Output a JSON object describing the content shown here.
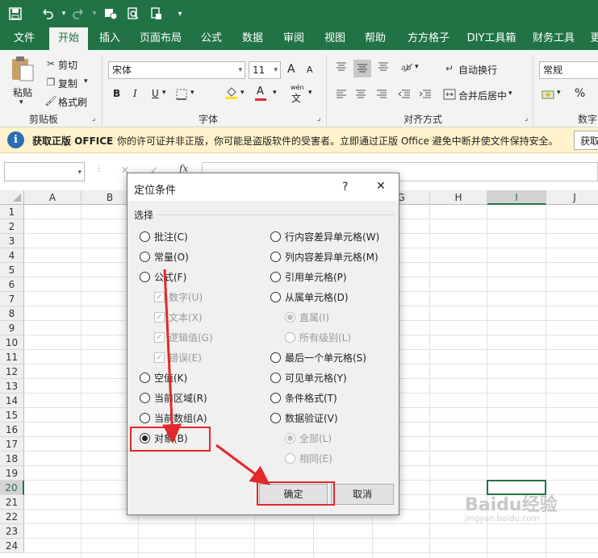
{
  "quick_access": {
    "icons": [
      "save-icon",
      "undo-icon",
      "redo-icon",
      "touch-mode-icon",
      "print-preview-icon",
      "print-icon",
      "customize-icon"
    ]
  },
  "tabs": [
    "文件",
    "开始",
    "插入",
    "页面布局",
    "公式",
    "数据",
    "审阅",
    "视图",
    "帮助",
    "方方格子",
    "DIY工具箱",
    "财务工具",
    "更"
  ],
  "active_tab": "开始",
  "ribbon": {
    "clipboard": {
      "paste": "粘贴",
      "cut": "剪切",
      "copy": "复制",
      "format_painter": "格式刷",
      "label": "剪贴板"
    },
    "font": {
      "name": "宋体",
      "size": "11",
      "bold": "B",
      "italic": "I",
      "underline": "U",
      "grow": "A",
      "shrink": "A",
      "font_color": "A",
      "wen": "wén",
      "wen_char": "文",
      "label": "字体"
    },
    "alignment": {
      "wrap": "自动换行",
      "merge": "合并后居中",
      "label": "对齐方式"
    },
    "number": {
      "format": "常规",
      "percent": "%",
      "label": "数字"
    }
  },
  "infobar": {
    "title": "获取正版 OFFICE",
    "message": "你的许可证并非正版，你可能是盗版软件的受害者。立即通过正版 Office 避免中断并使文件保持安全。",
    "button": "获取"
  },
  "formula_bar": {
    "name_box": "",
    "cancel": "✕",
    "enter": "✓",
    "fx": "fx"
  },
  "columns": [
    "A",
    "B",
    "C",
    "D",
    "E",
    "F",
    "G",
    "H",
    "I",
    "J"
  ],
  "rows": [
    "1",
    "2",
    "3",
    "4",
    "5",
    "6",
    "7",
    "8",
    "9",
    "10",
    "11",
    "12",
    "13",
    "14",
    "15",
    "16",
    "17",
    "18",
    "19",
    "20",
    "21",
    "22",
    "23",
    "24"
  ],
  "selected_cell": {
    "column": "I",
    "row": "20"
  },
  "dialog": {
    "title": "定位条件",
    "help": "?",
    "close": "✕",
    "section": "选择",
    "left": [
      {
        "label": "批注(C)",
        "kind": "radio",
        "checked": false,
        "disabled": false
      },
      {
        "label": "常量(O)",
        "kind": "radio",
        "checked": false,
        "disabled": false
      },
      {
        "label": "公式(F)",
        "kind": "radio",
        "checked": false,
        "disabled": false
      },
      {
        "label": "数字(U)",
        "kind": "check",
        "checked": true,
        "disabled": true
      },
      {
        "label": "文本(X)",
        "kind": "check",
        "checked": true,
        "disabled": true
      },
      {
        "label": "逻辑值(G)",
        "kind": "check",
        "checked": true,
        "disabled": true
      },
      {
        "label": "错误(E)",
        "kind": "check",
        "checked": true,
        "disabled": true
      },
      {
        "label": "空值(K)",
        "kind": "radio",
        "checked": false,
        "disabled": false
      },
      {
        "label": "当前区域(R)",
        "kind": "radio",
        "checked": false,
        "disabled": false
      },
      {
        "label": "当前数组(A)",
        "kind": "radio",
        "checked": false,
        "disabled": false
      },
      {
        "label": "对象(B)",
        "kind": "radio",
        "checked": true,
        "disabled": false
      }
    ],
    "right": [
      {
        "label": "行内容差异单元格(W)",
        "kind": "radio",
        "checked": false,
        "disabled": false
      },
      {
        "label": "列内容差异单元格(M)",
        "kind": "radio",
        "checked": false,
        "disabled": false
      },
      {
        "label": "引用单元格(P)",
        "kind": "radio",
        "checked": false,
        "disabled": false
      },
      {
        "label": "从属单元格(D)",
        "kind": "radio",
        "checked": false,
        "disabled": false
      },
      {
        "label": "直属(I)",
        "kind": "radio",
        "checked": true,
        "disabled": true
      },
      {
        "label": "所有级别(L)",
        "kind": "radio",
        "checked": false,
        "disabled": true
      },
      {
        "label": "最后一个单元格(S)",
        "kind": "radio",
        "checked": false,
        "disabled": false
      },
      {
        "label": "可见单元格(Y)",
        "kind": "radio",
        "checked": false,
        "disabled": false
      },
      {
        "label": "条件格式(T)",
        "kind": "radio",
        "checked": false,
        "disabled": false
      },
      {
        "label": "数据验证(V)",
        "kind": "radio",
        "checked": false,
        "disabled": false
      },
      {
        "label": "全部(L)",
        "kind": "radio",
        "checked": true,
        "disabled": true
      },
      {
        "label": "相同(E)",
        "kind": "radio",
        "checked": false,
        "disabled": true
      }
    ],
    "ok": "确定",
    "cancel": "取消"
  },
  "watermark": "Baidu经验",
  "watermark_url": "jingyan.baidu.com",
  "colors": {
    "excel_green": "#217346",
    "annotation_red": "#e3282a",
    "infobar_bg": "#fff2cc",
    "info_icon": "#2b6cb6"
  }
}
